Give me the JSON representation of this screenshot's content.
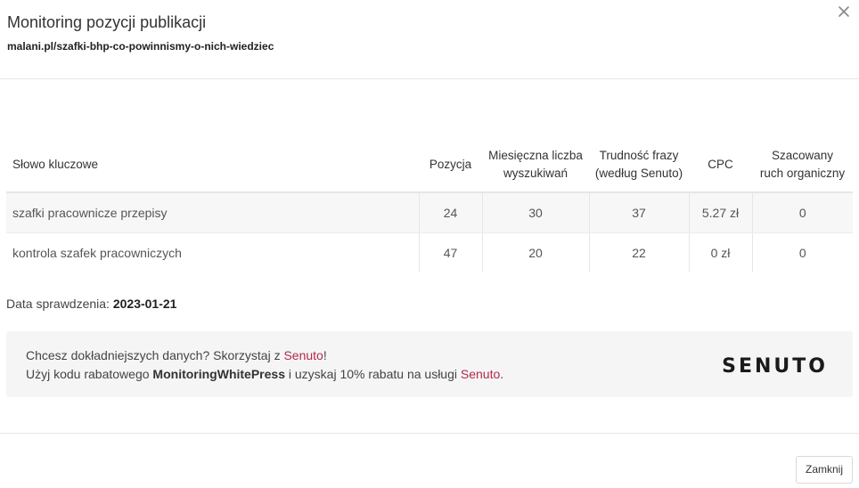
{
  "modal": {
    "title": "Monitoring pozycji publikacji",
    "url": "malani.pl/szafki-bhp-co-powinnismy-o-nich-wiedziec",
    "close_icon": "close-icon"
  },
  "table": {
    "headers": {
      "keyword": "Słowo kluczowe",
      "position": "Pozycja",
      "monthly_line1": "Miesięczna liczba",
      "monthly_line2": "wyszukiwań",
      "difficulty_line1": "Trudność frazy",
      "difficulty_line2": "(według Senuto)",
      "cpc": "CPC",
      "traffic_line1": "Szacowany",
      "traffic_line2": "ruch organiczny"
    },
    "rows": [
      {
        "keyword": "szafki pracownicze przepisy",
        "position": "24",
        "monthly": "30",
        "difficulty": "37",
        "cpc": "5.27 zł",
        "traffic": "0"
      },
      {
        "keyword": "kontrola szafek pracowniczych",
        "position": "47",
        "monthly": "20",
        "difficulty": "22",
        "cpc": "0 zł",
        "traffic": "0"
      }
    ]
  },
  "check": {
    "label": "Data sprawdzenia:",
    "date": "2023-01-21"
  },
  "promo": {
    "line1_prefix": "Chcesz dokładniejszych danych? Skorzystaj z ",
    "line1_link": "Senuto",
    "line1_suffix": "!",
    "line2_prefix": "Użyj kodu rabatowego ",
    "line2_code": "MonitoringWhitePress",
    "line2_middle": " i uzyskaj 10% rabatu na usługi ",
    "line2_link": "Senuto",
    "line2_suffix": ".",
    "logo_text": "SENUTO",
    "accent_color": "#b3294a"
  },
  "footer": {
    "close_label": "Zamknij"
  }
}
